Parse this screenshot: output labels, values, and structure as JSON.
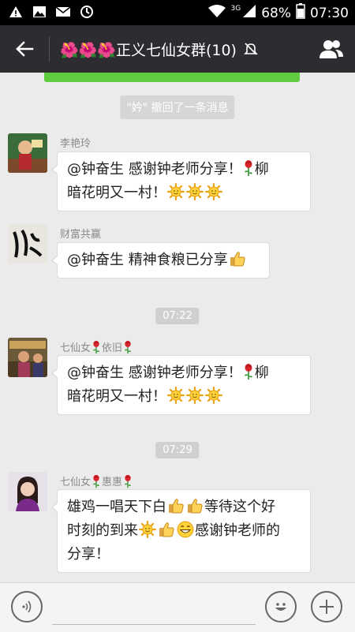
{
  "status_bar": {
    "network": "3G",
    "battery": "68%",
    "time": "07:30"
  },
  "header": {
    "title": "🌺🌺🌺正义七仙女群(10)",
    "muted": true
  },
  "system_message": "\"妗\" 撤回了一条消息",
  "messages": [
    {
      "sender": "李艳玲",
      "text_parts": [
        "@钟奋生 感谢钟老师分享！",
        "柳",
        "暗花明又一村！"
      ]
    },
    {
      "sender": "财富共赢",
      "text": "@钟奋生 精神食粮已分享"
    },
    {
      "time": "07:22"
    },
    {
      "sender_parts": [
        "七仙女",
        "依旧"
      ],
      "text_parts": [
        "@钟奋生 感谢钟老师分享！",
        "柳",
        "暗花明又一村！"
      ]
    },
    {
      "time": "07:29"
    },
    {
      "sender_parts": [
        "七仙女",
        "惠惠"
      ],
      "text_parts": [
        "雄鸡一唱天下白",
        "等待这个好",
        "时刻的到来",
        "感谢钟老师的",
        "分享！"
      ]
    }
  ],
  "icons": [
    "warning-icon",
    "image-icon",
    "mail-icon",
    "sync-icon",
    "wifi-icon",
    "signal-icon",
    "battery-icon",
    "back-arrow-icon",
    "mute-icon",
    "contacts-icon",
    "rose-icon",
    "sun-icon",
    "thumbs-up-icon",
    "grin-icon",
    "voice-icon",
    "emoji-icon",
    "plus-icon"
  ],
  "colors": {
    "title_bar": "#2c2c31",
    "background": "#ebebeb",
    "green": "#5fcc3f"
  }
}
